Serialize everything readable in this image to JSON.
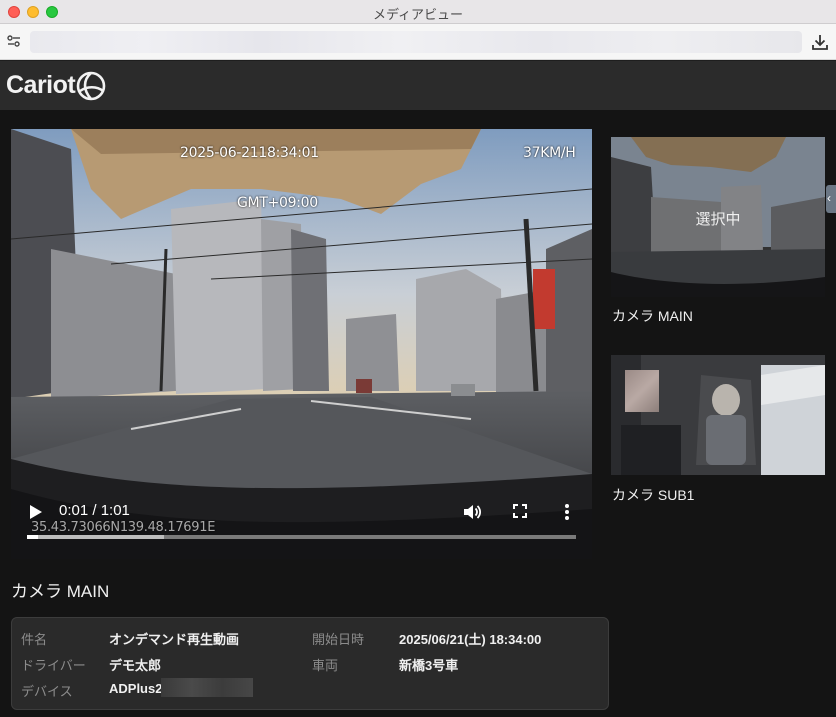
{
  "window": {
    "title": "メディアビュー"
  },
  "browser": {
    "download_icon": "download-icon",
    "site_settings_icon": "site-settings-icon"
  },
  "app": {
    "logo_text": "Cariot"
  },
  "player": {
    "overlay_timestamp": "2025-06-2118:34:01",
    "overlay_speed": "37KM/H",
    "overlay_timezone": "GMT+09:00",
    "overlay_coords": "35.43.73066N139.48.17691E",
    "time_display": "0:01 / 1:01",
    "progress_played": 0.02,
    "progress_buffered": 0.25
  },
  "main_title": "カメラ MAIN",
  "info": {
    "subject_label": "件名",
    "subject_value": "オンデマンド再生動画",
    "driver_label": "ドライバー",
    "driver_value": "デモ太郎",
    "device_label": "デバイス",
    "device_value": "ADPlus2-",
    "start_label": "開始日時",
    "start_value": "2025/06/21(土) 18:34:00",
    "vehicle_label": "車両",
    "vehicle_value": "新橋3号車"
  },
  "thumbnails": [
    {
      "label": "カメラ MAIN",
      "overlay": "選択中",
      "selected": true
    },
    {
      "label": "カメラ SUB1",
      "selected": false
    }
  ],
  "colors": {
    "background": "#141414",
    "panel": "#2a2a2a",
    "appbar": "#2b2b2b"
  }
}
